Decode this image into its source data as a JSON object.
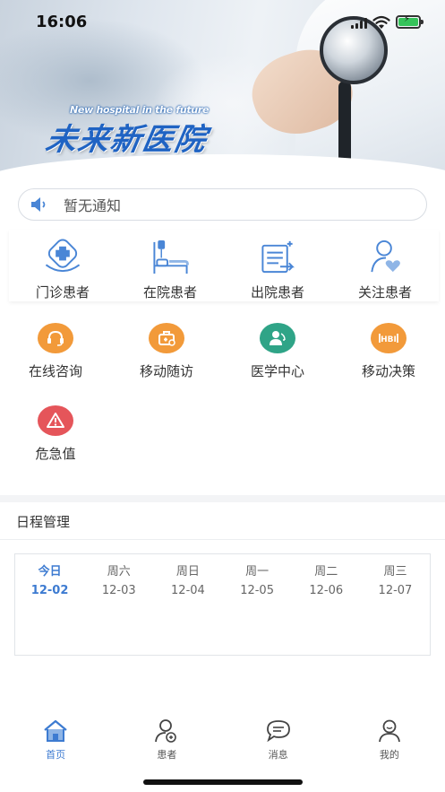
{
  "status_bar": {
    "time": "16:06"
  },
  "banner": {
    "slogan_en": "New hospital in the future",
    "slogan_cn": "未来新医院"
  },
  "notice": {
    "text": "暂无通知",
    "icon": "speaker-icon"
  },
  "patient_categories": [
    {
      "label": "门诊患者",
      "icon": "outpatient-icon"
    },
    {
      "label": "在院患者",
      "icon": "inpatient-bed-icon"
    },
    {
      "label": "出院患者",
      "icon": "discharge-icon"
    },
    {
      "label": "关注患者",
      "icon": "follow-patient-icon"
    }
  ],
  "functions": [
    {
      "label": "在线咨询",
      "icon": "headset-icon",
      "color": "#f29a3a"
    },
    {
      "label": "移动随访",
      "icon": "medical-kit-icon",
      "color": "#f29a3a"
    },
    {
      "label": "医学中心",
      "icon": "doctor-icon",
      "color": "#2fa487"
    },
    {
      "label": "移动决策",
      "icon": "decision-icon",
      "color": "#f29a3a"
    },
    {
      "label": "危急值",
      "icon": "warning-icon",
      "color": "#e5555a"
    }
  ],
  "schedule": {
    "title": "日程管理",
    "days": [
      {
        "weekday": "今日",
        "date": "12-02",
        "today": true
      },
      {
        "weekday": "周六",
        "date": "12-03"
      },
      {
        "weekday": "周日",
        "date": "12-04"
      },
      {
        "weekday": "周一",
        "date": "12-05"
      },
      {
        "weekday": "周二",
        "date": "12-06"
      },
      {
        "weekday": "周三",
        "date": "12-07"
      }
    ]
  },
  "tabbar": {
    "items": [
      {
        "label": "首页",
        "icon": "home-icon",
        "active": true
      },
      {
        "label": "患者",
        "icon": "patient-icon"
      },
      {
        "label": "消息",
        "icon": "message-icon"
      },
      {
        "label": "我的",
        "icon": "profile-icon"
      }
    ]
  },
  "colors": {
    "accent": "#3d7bd1",
    "brand": "#1f63c3",
    "warning": "#e5555a",
    "orange": "#f29a3a",
    "teal": "#2fa487"
  }
}
